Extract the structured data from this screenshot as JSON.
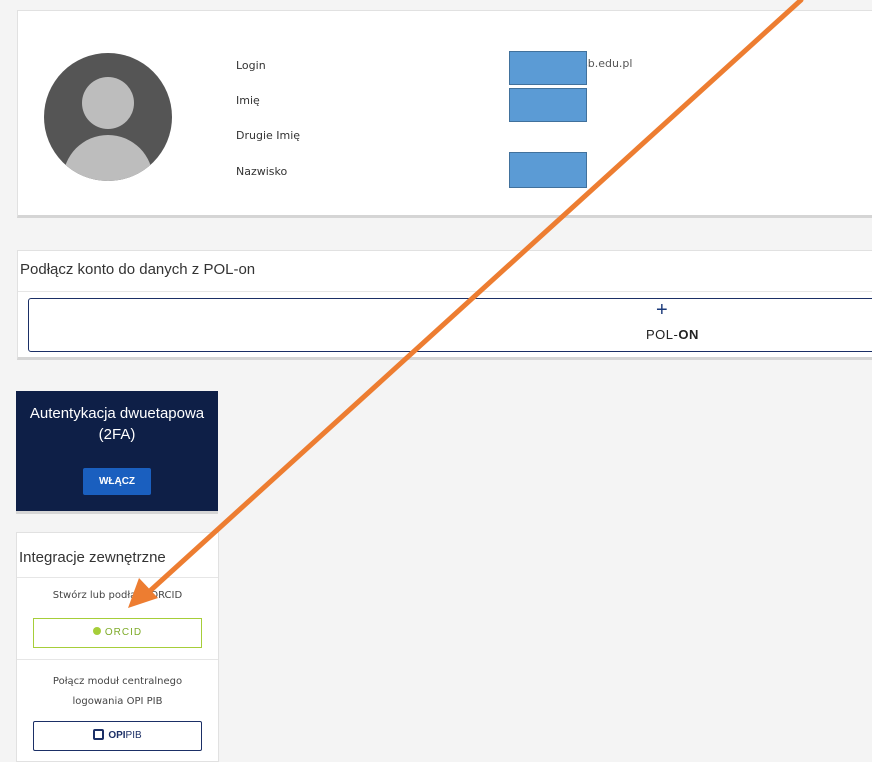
{
  "profile": {
    "fields": [
      {
        "label": "Login",
        "value": "sb.edu.pl"
      },
      {
        "label": "Imię",
        "value": ""
      },
      {
        "label": "Drugie Imię",
        "value": ""
      },
      {
        "label": "Nazwisko",
        "value": ""
      }
    ]
  },
  "polon": {
    "title": "Podłącz konto do danych z POL-on",
    "plus": "+",
    "logo_left": "POL-",
    "logo_right": "ON"
  },
  "twofa": {
    "title": "Autentykacja dwuetapowa (2FA)",
    "button": "WŁĄCZ"
  },
  "integrations": {
    "title": "Integracje zewnętrzne",
    "orcid_text": "Stwórz lub podłącz ORCID",
    "orcid_button": "ORCID",
    "opi_text": "Połącz moduł centralnego logowania OPI PIB",
    "opi_button_left": "OPI",
    "opi_button_right": "PIB"
  },
  "annotation": {
    "color": "#ed7d31"
  }
}
